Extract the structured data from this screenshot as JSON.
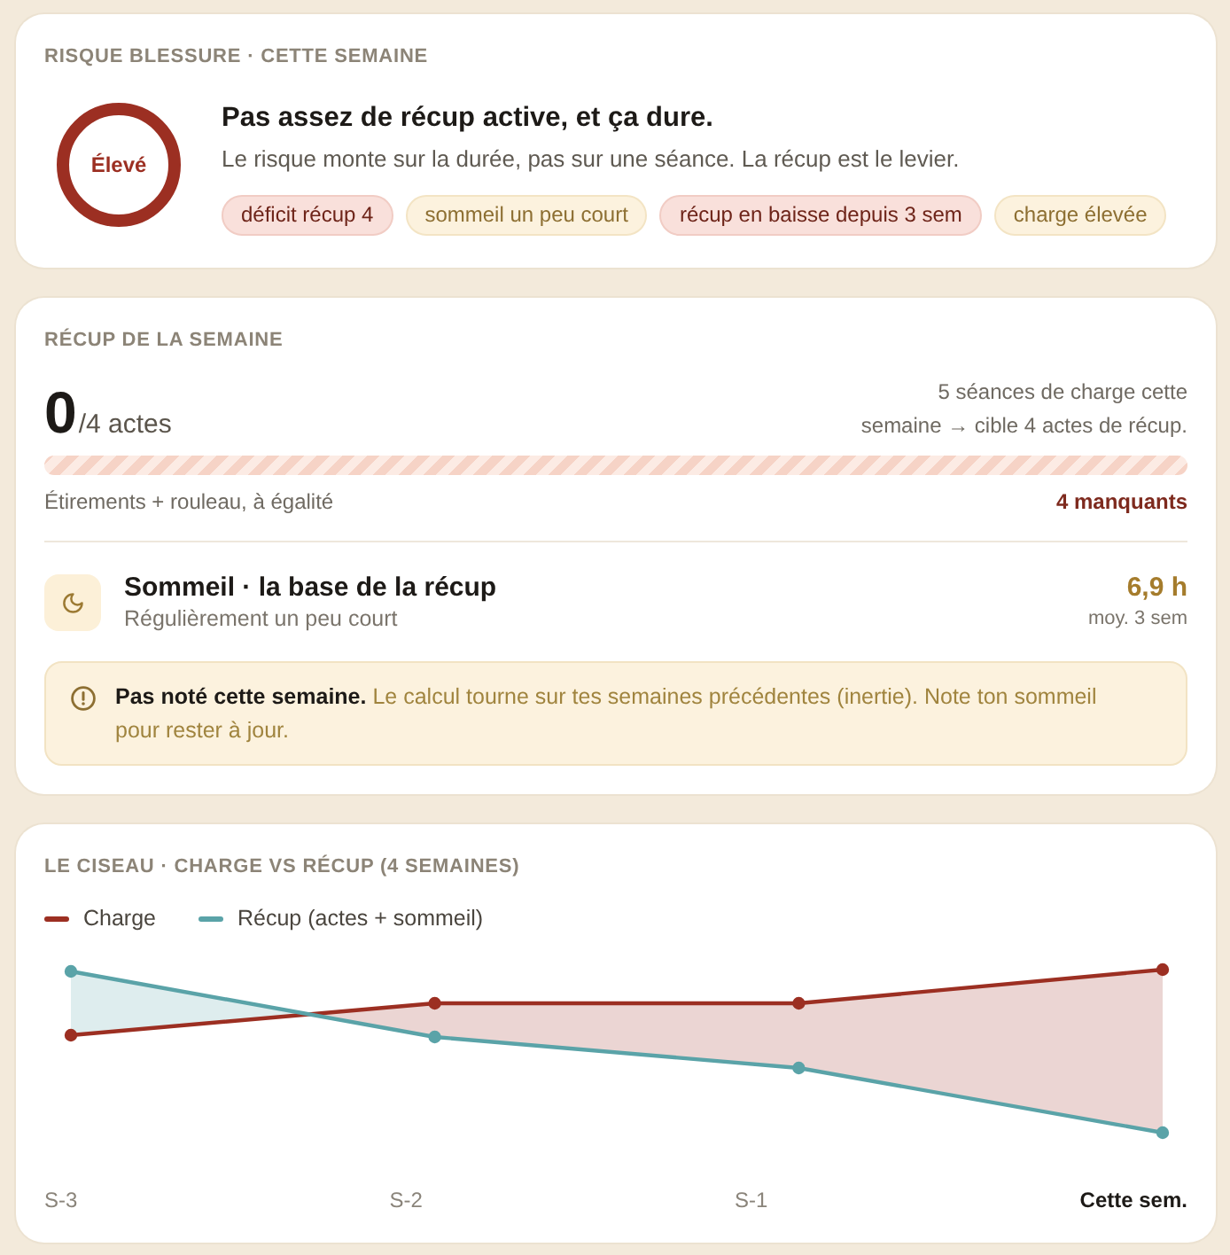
{
  "risk_card": {
    "title": "RISQUE BLESSURE · CETTE SEMAINE",
    "gauge": {
      "label": "Élevé",
      "alert": true
    },
    "headline": "Pas assez de récup active, et ça dure.",
    "description": "Le risque monte sur la durée, pas sur une séance. La récup est le levier.",
    "tags": [
      {
        "label": "déficit récup 4",
        "alert": true
      },
      {
        "label": "sommeil un peu court",
        "alert": false
      },
      {
        "label": "récup en baisse depuis 3 sem",
        "alert": true
      },
      {
        "label": "charge élevée",
        "alert": false
      }
    ]
  },
  "recovery_card": {
    "title": "RÉCUP DE LA SEMAINE",
    "count": "0",
    "target": "/4 actes",
    "note": "5 séances de charge cette semaine → cible 4 actes de récup.",
    "progress_caption": "Étirements + rouleau, à égalité",
    "missing": "4 manquants",
    "sleep": {
      "title": "Sommeil · la base de la récup",
      "subtitle": "Régulièrement un peu court",
      "value": "6,9 h",
      "value_caption": "moy. 3 sem"
    },
    "notice": {
      "text": "**Pas noté cette semaine.** Le calcul tourne sur tes semaines précédentes (inertie). Note ton sommeil pour rester à jour."
    }
  },
  "trend_card": {
    "title": "LE CISEAU · CHARGE VS RÉCUP (4 SEMAINES)",
    "legend": [
      {
        "label": "Charge",
        "color": "#9c2f22"
      },
      {
        "label": "Récup (actes + sommeil)",
        "color": "#5aa3a8"
      }
    ],
    "x_labels": [
      {
        "label": "S-3",
        "current": false
      },
      {
        "label": "S-2",
        "current": false
      },
      {
        "label": "S-1",
        "current": false
      },
      {
        "label": "Cette sem.",
        "current": true
      }
    ]
  }
}
